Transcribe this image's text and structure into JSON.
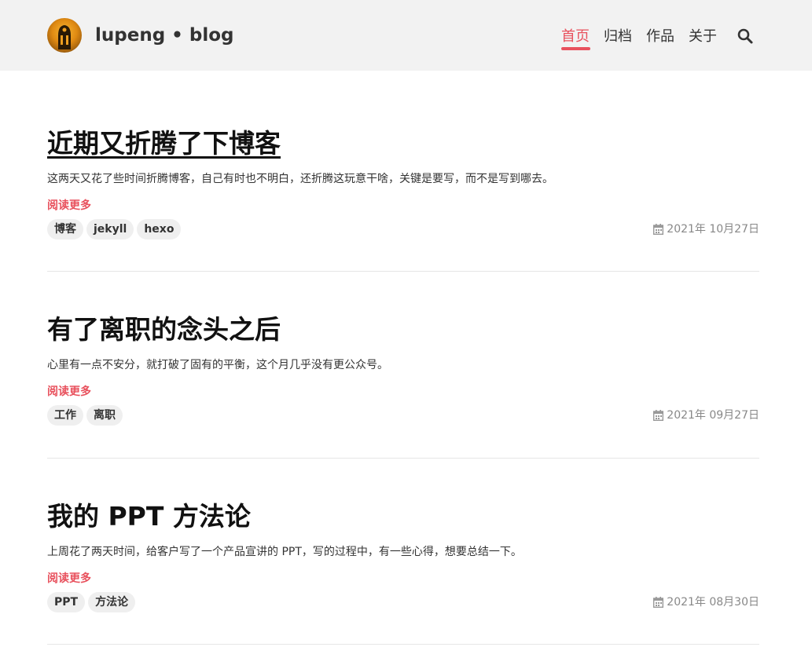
{
  "header": {
    "site_title": "lupeng • blog",
    "logo_icon": "avatar-logo",
    "nav": [
      {
        "label": "首页",
        "active": true
      },
      {
        "label": "归档",
        "active": false
      },
      {
        "label": "作品",
        "active": false
      },
      {
        "label": "关于",
        "active": false
      }
    ],
    "search_icon": "search-icon",
    "accent_color": "#e8515d"
  },
  "posts": [
    {
      "title": "近期又折腾了下博客",
      "excerpt": "这两天又花了些时间折腾博客，自己有时也不明白，还折腾这玩意干啥，关键是要写，而不是写到哪去。",
      "read_more": "阅读更多",
      "tags": [
        "博客",
        "jekyll",
        "hexo"
      ],
      "date": "2021年 10月27日"
    },
    {
      "title": "有了离职的念头之后",
      "excerpt": "心里有一点不安分，就打破了固有的平衡，这个月几乎没有更公众号。",
      "read_more": "阅读更多",
      "tags": [
        "工作",
        "离职"
      ],
      "date": "2021年 09月27日"
    },
    {
      "title": "我的 PPT 方法论",
      "excerpt": "上周花了两天时间，给客户写了一个产品宣讲的 PPT，写的过程中，有一些心得，想要总结一下。",
      "read_more": "阅读更多",
      "tags": [
        "PPT",
        "方法论"
      ],
      "date": "2021年 08月30日"
    }
  ]
}
